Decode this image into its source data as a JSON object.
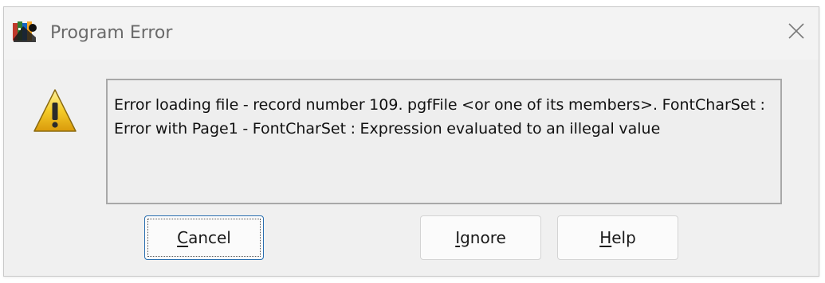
{
  "window": {
    "title": "Program Error",
    "app_icon": "multicolor-program-icon",
    "close_icon": "close-x-icon"
  },
  "message": {
    "icon": "warning-triangle-icon",
    "text": "Error loading file - record number 109.  pgfFile <or one of its members>.  FontCharSet : Error with Page1 - FontCharSet : Expression evaluated to an illegal value"
  },
  "buttons": {
    "cancel": {
      "mnemonic": "C",
      "rest": "ancel"
    },
    "ignore": {
      "mnemonic": "I",
      "rest": "gnore"
    },
    "help": {
      "mnemonic": "H",
      "rest": "elp"
    }
  },
  "colors": {
    "dialog_background": "#f0f0f0",
    "focus_border": "#2a6fb0",
    "warning_yellow": "#f2c21b"
  }
}
